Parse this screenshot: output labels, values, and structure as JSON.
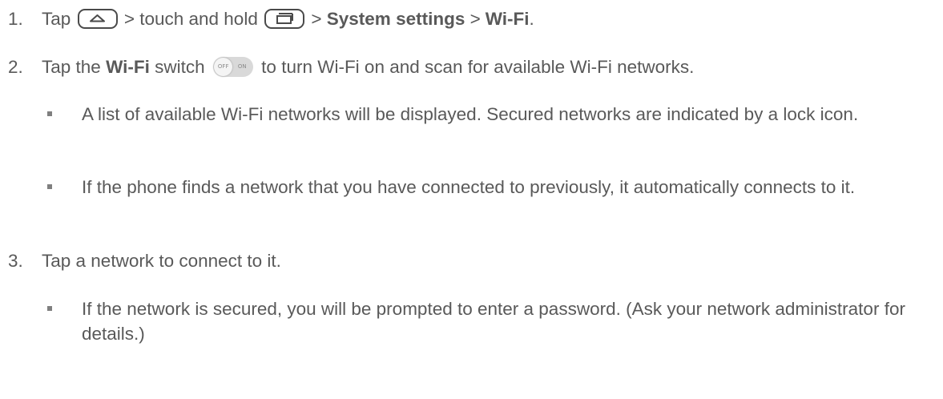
{
  "steps": [
    {
      "number": "1.",
      "parts": {
        "tap": "Tap",
        "sep1": "> touch and hold",
        "sep2": ">",
        "system_settings": "System settings",
        "sep3": ">",
        "wifi": "Wi-Fi",
        "end": "."
      },
      "icons": [
        "home-key-icon",
        "recent-apps-key-icon"
      ]
    },
    {
      "number": "2.",
      "parts": {
        "tap_the": "Tap the",
        "wifi": "Wi-Fi",
        "switch": "switch",
        "rest": "to turn Wi-Fi on and scan for available Wi-Fi networks."
      },
      "toggle": {
        "off_label": "OFF",
        "on_label": "ON"
      },
      "bullets": [
        "A list of available Wi-Fi networks will be displayed. Secured networks are indicated by a lock icon.",
        "If the phone finds a network that you have connected to previously, it automatically connects to it."
      ]
    },
    {
      "number": "3.",
      "text": "Tap a network to connect to it.",
      "bullets": [
        "If the network is secured, you will be prompted to enter a password. (Ask your network administrator for details.)"
      ]
    }
  ],
  "colors": {
    "text": "#595959",
    "icon_border": "#4a4a4a",
    "bullet": "#7f7f7f",
    "toggle_track": "#d9d9d9"
  }
}
